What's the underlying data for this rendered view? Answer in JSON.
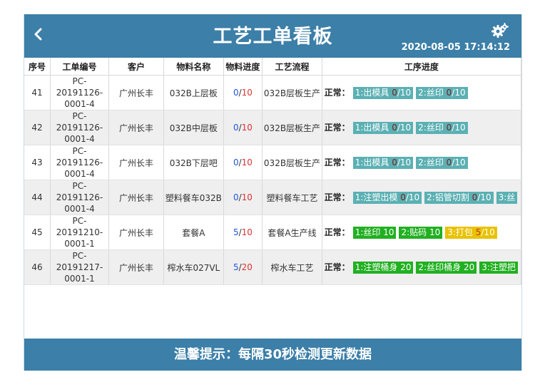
{
  "header": {
    "title": "工艺工单看板",
    "datetime": "2020-08-05 17:14:12",
    "back_icon": "chevron-left-icon",
    "settings_icon": "gears-icon"
  },
  "table": {
    "headers": [
      "序号",
      "工单编号",
      "客户",
      "物料名称",
      "物料进度",
      "工艺流程",
      "工序进度"
    ],
    "status_label": "正常：",
    "rows": [
      {
        "seq": "41",
        "order": "PC-20191126-0001-4",
        "customer": "广州长丰",
        "material": "032B上层板",
        "progress_done": "0",
        "progress_total": "10",
        "flow": "032B层板生产",
        "steps": [
          {
            "name": "1:出模具 ",
            "done": "0",
            "total": "/10",
            "color": "teal"
          },
          {
            "name": "2:丝印 ",
            "done": "0",
            "total": "/10",
            "color": "teal"
          }
        ]
      },
      {
        "seq": "42",
        "order": "PC-20191126-0001-4",
        "customer": "广州长丰",
        "material": "032B中层板",
        "progress_done": "0",
        "progress_total": "10",
        "flow": "032B层板生产",
        "steps": [
          {
            "name": "1:出模具 ",
            "done": "0",
            "total": "/10",
            "color": "teal"
          },
          {
            "name": "2:丝印 ",
            "done": "0",
            "total": "/10",
            "color": "teal"
          }
        ]
      },
      {
        "seq": "43",
        "order": "PC-20191126-0001-4",
        "customer": "广州长丰",
        "material": "032B下层吧",
        "progress_done": "0",
        "progress_total": "10",
        "flow": "032B层板生产",
        "steps": [
          {
            "name": "1:出模具 ",
            "done": "0",
            "total": "/10",
            "color": "teal"
          },
          {
            "name": "2:丝印 ",
            "done": "0",
            "total": "/10",
            "color": "teal"
          }
        ]
      },
      {
        "seq": "44",
        "order": "PC-20191126-0001-4",
        "customer": "广州长丰",
        "material": "塑料餐车032B",
        "progress_done": "0",
        "progress_total": "10",
        "flow": "塑料餐车工艺",
        "steps": [
          {
            "name": "1:注塑出模 ",
            "done": "0",
            "total": "/10",
            "color": "teal"
          },
          {
            "name": "2:铝管切割 ",
            "done": "0",
            "total": "/10",
            "color": "teal"
          },
          {
            "name": "3:丝",
            "done": "",
            "total": "",
            "color": "teal"
          }
        ]
      },
      {
        "seq": "45",
        "order": "PC-20191210-0001-1",
        "customer": "广州长丰",
        "material": "套餐A",
        "progress_done": "5",
        "progress_total": "10",
        "flow": "套餐A生产线",
        "steps": [
          {
            "name": "1:丝印 ",
            "done": "10",
            "total": "",
            "color": "green"
          },
          {
            "name": "2:贴码 ",
            "done": "10",
            "total": "",
            "color": "green"
          },
          {
            "name": "3:打包 ",
            "done": "5",
            "total": "/10",
            "color": "yellow"
          }
        ]
      },
      {
        "seq": "46",
        "order": "PC-20191217-0001-1",
        "customer": "广州长丰",
        "material": "榨水车027VL",
        "progress_done": "5",
        "progress_total": "20",
        "flow": "榨水车工艺",
        "steps": [
          {
            "name": "1:注塑桶身 ",
            "done": "20",
            "total": "",
            "color": "green"
          },
          {
            "name": "2:丝印桶身 ",
            "done": "20",
            "total": "",
            "color": "green"
          },
          {
            "name": "3:注塑把",
            "done": "",
            "total": "",
            "color": "green"
          }
        ]
      }
    ]
  },
  "footer": {
    "notice": "温馨提示：每隔30秒检测更新数据"
  }
}
